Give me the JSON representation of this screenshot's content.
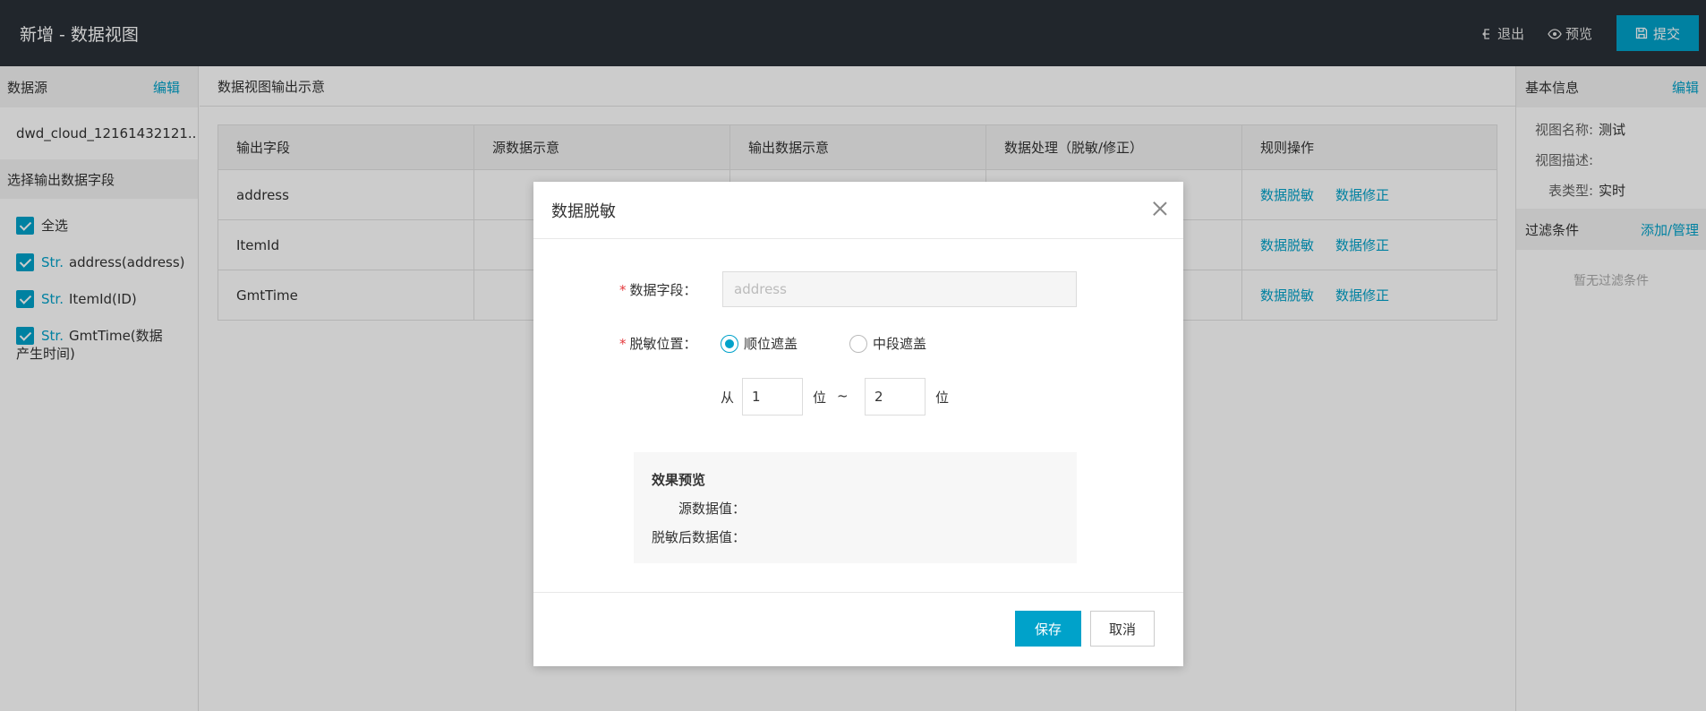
{
  "header": {
    "title": "新增 - 数据视图",
    "exit_label": "退出",
    "preview_label": "预览",
    "submit_label": "提交"
  },
  "left": {
    "title": "数据源",
    "edit_label": "编辑",
    "datasource": "dwd_cloud_12161432121...",
    "select_title": "选择输出数据字段",
    "select_all": "全选",
    "fields": [
      {
        "type": "Str.",
        "label": "address(address)"
      },
      {
        "type": "Str.",
        "label": "ItemId(ID)"
      },
      {
        "type": "Str.",
        "label": "GmtTime(数据产生时间)"
      }
    ]
  },
  "main": {
    "title": "数据视图输出示意",
    "columns": [
      "输出字段",
      "源数据示意",
      "输出数据示意",
      "数据处理（脱敏/修正）",
      "规则操作"
    ],
    "rows": [
      {
        "field": "address",
        "mask": "数据脱敏",
        "fix": "数据修正"
      },
      {
        "field": "ItemId",
        "mask": "数据脱敏",
        "fix": "数据修正"
      },
      {
        "field": "GmtTime",
        "mask": "数据脱敏",
        "fix": "数据修正"
      }
    ]
  },
  "right": {
    "title": "基本信息",
    "edit_label": "编辑",
    "name_key": "视图名称:",
    "name_val": "测试",
    "desc_key": "视图描述:",
    "type_key": "表类型:",
    "type_val": "实时",
    "filter_title": "过滤条件",
    "filter_action": "添加/管理",
    "filter_empty": "暂无过滤条件"
  },
  "modal": {
    "title": "数据脱敏",
    "field_label": "数据字段：",
    "field_placeholder": "address",
    "position_label": "脱敏位置：",
    "radio_prefix": "顺位遮盖",
    "radio_middle": "中段遮盖",
    "from_label": "从",
    "from_value": "1",
    "unit1": "位",
    "tilde": "~",
    "to_value": "2",
    "unit2": "位",
    "preview_title": "效果预览",
    "source_label": "源数据值：",
    "masked_label": "脱敏后数据值：",
    "save_label": "保存",
    "cancel_label": "取消"
  }
}
